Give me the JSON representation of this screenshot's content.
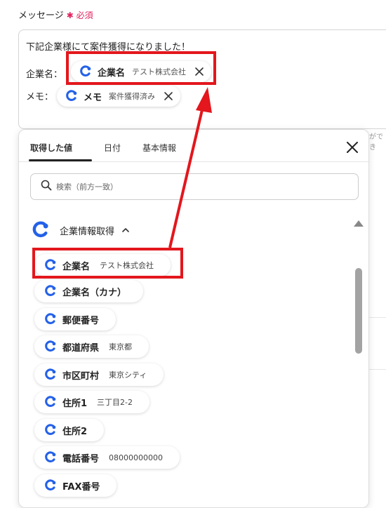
{
  "field": {
    "label": "メッセージ",
    "required_mark": "✱",
    "required_label": "必須"
  },
  "editor": {
    "line1": "下記企業様にて案件獲得になりました！",
    "row1_prefix": "企業名：",
    "row1_pill": {
      "name": "企業名",
      "value": "テスト株式会社"
    },
    "row2_prefix": "メモ：",
    "row2_pill": {
      "name": "メモ",
      "value": "案件獲得済み"
    }
  },
  "hint_text": "ができ",
  "tabs": [
    {
      "label": "取得した値",
      "active": true
    },
    {
      "label": "日付",
      "active": false
    },
    {
      "label": "基本情報",
      "active": false
    }
  ],
  "search": {
    "placeholder": "検索（前方一致）",
    "icon": "search-icon"
  },
  "group": {
    "title": "企業情報取得",
    "expanded": true,
    "icon": "app-logo-icon",
    "toggle_icon": "chevron-up-icon"
  },
  "items": [
    {
      "name": "企業名",
      "value": "テスト株式会社"
    },
    {
      "name": "企業名（カナ）",
      "value": ""
    },
    {
      "name": "郵便番号",
      "value": ""
    },
    {
      "name": "都道府県",
      "value": "東京都"
    },
    {
      "name": "市区町村",
      "value": "東京シティ"
    },
    {
      "name": "住所1",
      "value": "三丁目2-2"
    },
    {
      "name": "住所2",
      "value": ""
    },
    {
      "name": "電話番号",
      "value": "08000000000"
    },
    {
      "name": "FAX番号",
      "value": ""
    }
  ],
  "colors": {
    "logo_blue": "#2461e8",
    "required_red": "#e0245e",
    "highlight_red": "#e3171d"
  }
}
